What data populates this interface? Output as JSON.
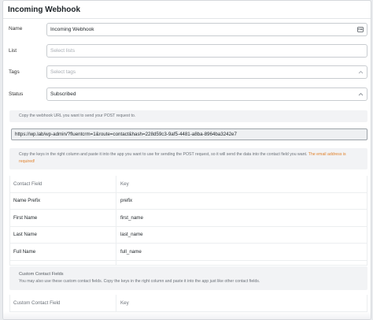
{
  "dialog": {
    "title": "Incoming Webhook"
  },
  "form": {
    "name_label": "Name",
    "name_value": "Incoming Webhook",
    "list_label": "List",
    "list_placeholder": "Select lists",
    "tags_label": "Tags",
    "tags_placeholder": "Select tags",
    "status_label": "Status",
    "status_value": "Subscribed"
  },
  "webhook": {
    "instruction": "Copy the webhook URL you want to send your POST request to.",
    "url": "https://wp.lab/wp-admin/?fluentcrm=1&route=contact&hash=228d59c3-9af5-4481-a8ba-8964ba3242e7",
    "keys_instruction": "Copy the keys in the right column and paste it into the app you want to use for sending the POST request, so it will send the data into the contact field you want.",
    "keys_required_note": "The email address is required!"
  },
  "contact_table": {
    "headers": [
      "Contact Field",
      "Key"
    ],
    "rows": [
      [
        "Name Prefix",
        "prefix"
      ],
      [
        "First Name",
        "first_name"
      ],
      [
        "Last Name",
        "last_name"
      ],
      [
        "Full Name",
        "full_name"
      ]
    ]
  },
  "custom_fields": {
    "heading": "Custom Contact Fields",
    "description": "You may also use these custom contact fields. Copy the keys in the right column and paste it into the app just like other contact fields."
  },
  "custom_table": {
    "headers": [
      "Custom Contact Field",
      "Key"
    ]
  }
}
